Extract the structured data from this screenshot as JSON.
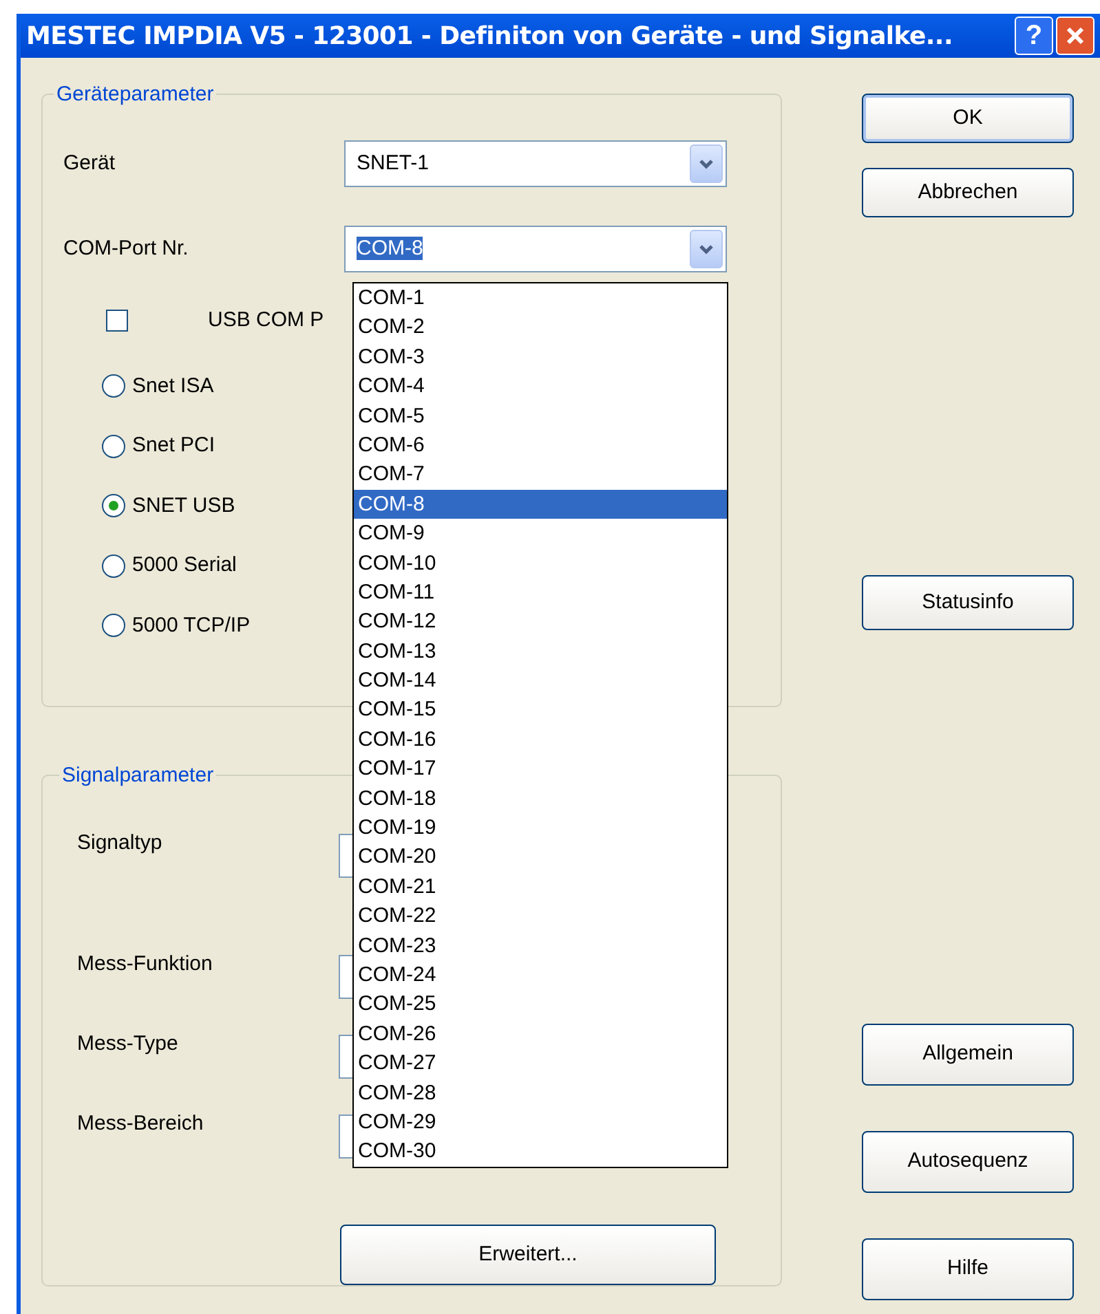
{
  "window": {
    "title": "MESTEC IMPDIA V5 - 123001 - Definiton von Geräte - und Signalke...",
    "help_button": "?"
  },
  "device_group": {
    "title": "Geräteparameter",
    "fields": [
      {
        "label": "Gerät",
        "value": "SNET-1",
        "focused": false
      },
      {
        "label": "COM-Port Nr.",
        "value": "COM-8",
        "focused": true
      }
    ],
    "checkbox": {
      "label": "USB COM P",
      "checked": false
    },
    "radios": [
      {
        "label": "Snet ISA",
        "selected": false
      },
      {
        "label": "Snet PCI",
        "selected": false
      },
      {
        "label": "SNET USB",
        "selected": true
      },
      {
        "label": "5000 Serial",
        "selected": false
      },
      {
        "label": "5000 TCP/IP",
        "selected": false
      }
    ]
  },
  "dropdown_list": [
    {
      "label": "COM-1",
      "selected": false
    },
    {
      "label": "COM-2",
      "selected": false
    },
    {
      "label": "COM-3",
      "selected": false
    },
    {
      "label": "COM-4",
      "selected": false
    },
    {
      "label": "COM-5",
      "selected": false
    },
    {
      "label": "COM-6",
      "selected": false
    },
    {
      "label": "COM-7",
      "selected": false
    },
    {
      "label": "COM-8",
      "selected": true
    },
    {
      "label": "COM-9",
      "selected": false
    },
    {
      "label": "COM-10",
      "selected": false
    },
    {
      "label": "COM-11",
      "selected": false
    },
    {
      "label": "COM-12",
      "selected": false
    },
    {
      "label": "COM-13",
      "selected": false
    },
    {
      "label": "COM-14",
      "selected": false
    },
    {
      "label": "COM-15",
      "selected": false
    },
    {
      "label": "COM-16",
      "selected": false
    },
    {
      "label": "COM-17",
      "selected": false
    },
    {
      "label": "COM-18",
      "selected": false
    },
    {
      "label": "COM-19",
      "selected": false
    },
    {
      "label": "COM-20",
      "selected": false
    },
    {
      "label": "COM-21",
      "selected": false
    },
    {
      "label": "COM-22",
      "selected": false
    },
    {
      "label": "COM-23",
      "selected": false
    },
    {
      "label": "COM-24",
      "selected": false
    },
    {
      "label": "COM-25",
      "selected": false
    },
    {
      "label": "COM-26",
      "selected": false
    },
    {
      "label": "COM-27",
      "selected": false
    },
    {
      "label": "COM-28",
      "selected": false
    },
    {
      "label": "COM-29",
      "selected": false
    },
    {
      "label": "COM-30",
      "selected": false
    }
  ],
  "signal_group": {
    "title": "Signalparameter",
    "fields": [
      {
        "label": "Signaltyp"
      },
      {
        "label": "Mess-Funktion"
      },
      {
        "label": "Mess-Type"
      },
      {
        "label": "Mess-Bereich"
      }
    ],
    "button": "Erweitert..."
  },
  "buttons_top": [
    "OK",
    "Abbrechen"
  ],
  "button_middle": "Statusinfo",
  "buttons_bottom": [
    "Allgemein",
    "Autosequenz",
    "Hilfe"
  ]
}
